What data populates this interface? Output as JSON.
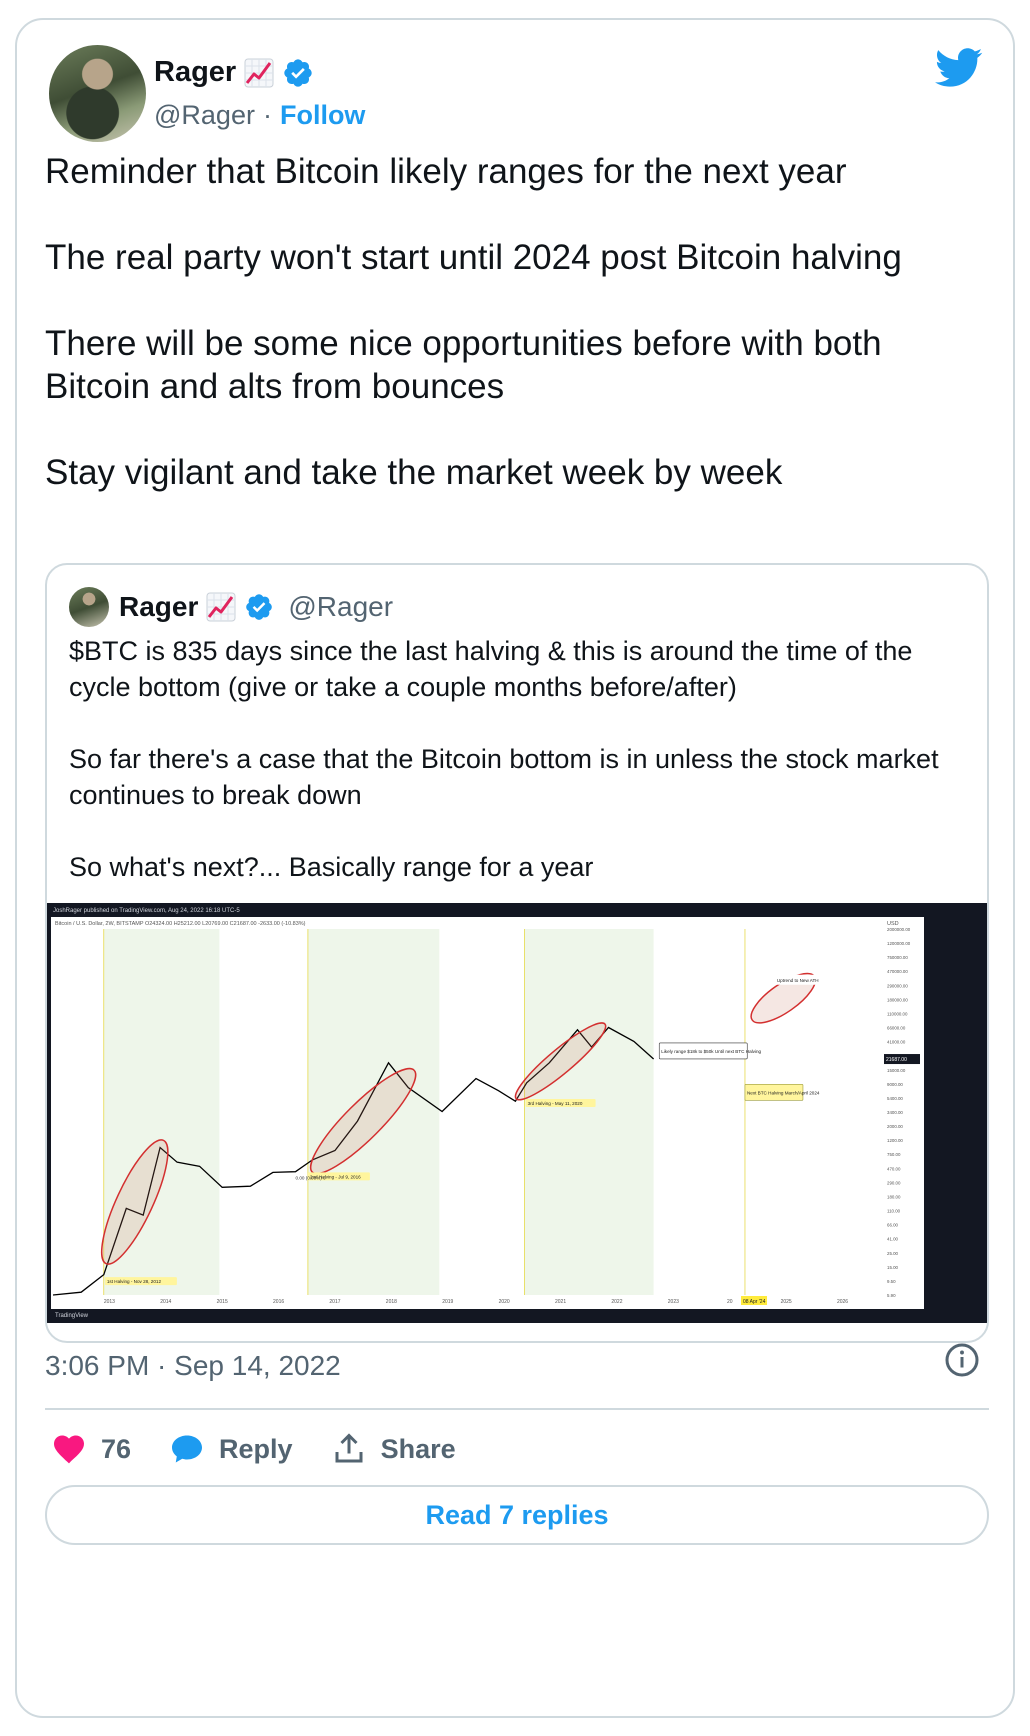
{
  "author": {
    "name": "Rager",
    "handle": "@Rager",
    "follow_label": "Follow",
    "separator": "·",
    "badge_emoji": "chart-increasing-icon",
    "verified": "verified-badge-icon"
  },
  "tweet": {
    "paragraphs": [
      "Reminder that Bitcoin likely ranges for the next year",
      "The real party won't start until 2024 post Bitcoin halving",
      "There will be some nice opportunities before with both Bitcoin and alts from bounces",
      "Stay vigilant and take the market week by week"
    ]
  },
  "quoted": {
    "name": "Rager",
    "handle": "@Rager",
    "paragraphs": [
      "$BTC is 835 days since the last halving & this is around the time of the cycle bottom (give or take a couple months before/after)",
      "So far there's a case that the Bitcoin bottom is in unless the stock market continues to break down",
      "So what's next?... Basically range for a year"
    ],
    "image": {
      "top_caption": "JoshRager published on TradingView.com, Aug 24, 2022 16:18 UTC-5",
      "symbol_line": "Bitcoin / U.S. Dollar, 2W, BITSTAMP  O24324.00  H25212.00  L20769.00  C21687.00  -2633.00 (-10.83%)",
      "watermark": "TradingView",
      "currency": "USD",
      "annotations": {
        "range_box": "Likely range $18k to $50k Until next BTC Halving",
        "uptrend": "Uptrend to New ATH",
        "next_halving": "Next BTC Halving March/April 2024",
        "halving1": "1st Halving - Nov 28, 2012",
        "halving2": "2nd Halving - Jul 9, 2016",
        "halving3": "3rd Halving - May 11, 2020",
        "zero_label": "0.00 (0.00%) 0",
        "date_marker": "08 Apr '24",
        "price_tag": "21687.00"
      }
    }
  },
  "chart_data": {
    "type": "line",
    "title": "Bitcoin / U.S. Dollar, 2W, BITSTAMP",
    "x_ticks": [
      "2013",
      "2014",
      "2015",
      "2016",
      "2017",
      "2018",
      "2019",
      "2020",
      "2021",
      "2022",
      "2023",
      "20",
      "2025",
      "2026"
    ],
    "y_ticks": [
      "2000000.00",
      "1200000.00",
      "750000.00",
      "470000.00",
      "290000.00",
      "180000.00",
      "110000.00",
      "66000.00",
      "41000.00",
      "26000.00",
      "15000.00",
      "9000.00",
      "5400.00",
      "3400.00",
      "2000.00",
      "1200.00",
      "750.00",
      "470.00",
      "290.00",
      "180.00",
      "110.00",
      "66.00",
      "41.00",
      "25.00",
      "15.00",
      "9.50",
      "5.90"
    ],
    "y_scale": "log",
    "series": [
      {
        "x": [
          2012.0,
          2012.5,
          2012.9,
          2013.3,
          2013.6,
          2013.9,
          2014.2,
          2014.6,
          2015.0,
          2015.5,
          2015.9,
          2016.3,
          2016.6,
          2017.0,
          2017.4,
          2017.95,
          2018.3,
          2018.9,
          2019.5,
          2019.9,
          2020.2,
          2020.4,
          2020.8,
          2021.3,
          2021.55,
          2021.85,
          2022.3,
          2022.65
        ],
        "y": [
          5.9,
          6.5,
          12,
          120,
          95,
          1000,
          600,
          520,
          250,
          260,
          420,
          430,
          650,
          900,
          2500,
          19000,
          8000,
          3500,
          11000,
          7200,
          5000,
          9500,
          19000,
          60000,
          33000,
          65000,
          40000,
          21687
        ]
      }
    ]
  },
  "footer": {
    "timestamp": "3:06 PM · Sep 14, 2022",
    "likes": "76",
    "reply_label": "Reply",
    "share_label": "Share",
    "read_replies": "Read 7 replies"
  },
  "colors": {
    "accent": "#1d9bf0",
    "like": "#f91880",
    "muted": "#536471",
    "border": "#cfd9de"
  }
}
